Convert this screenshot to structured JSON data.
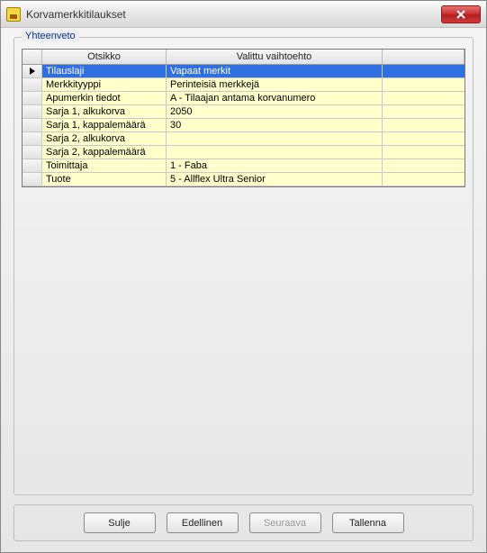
{
  "window": {
    "title": "Korvamerkkitilaukset"
  },
  "groupbox": {
    "label": "Yhteenveto"
  },
  "grid": {
    "headers": {
      "col1": "Otsikko",
      "col2": "Valittu vaihtoehto"
    },
    "rows": [
      {
        "label": "Tilauslaji",
        "value": "Vapaat merkit",
        "selected": true
      },
      {
        "label": "Merkkityyppi",
        "value": "Perinteisiä merkkejä",
        "selected": false
      },
      {
        "label": "Apumerkin tiedot",
        "value": "A - Tilaajan antama korvanumero",
        "selected": false
      },
      {
        "label": "Sarja 1, alkukorva",
        "value": "2050",
        "selected": false
      },
      {
        "label": "Sarja 1, kappalemäärä",
        "value": "30",
        "selected": false
      },
      {
        "label": "Sarja 2, alkukorva",
        "value": "",
        "selected": false
      },
      {
        "label": "Sarja 2, kappalemäärä",
        "value": "",
        "selected": false
      },
      {
        "label": "Toimittaja",
        "value": "1 - Faba",
        "selected": false
      },
      {
        "label": "Tuote",
        "value": "5 - Allflex Ultra Senior",
        "selected": false
      }
    ]
  },
  "buttons": {
    "close": "Sulje",
    "prev": "Edellinen",
    "next": "Seuraava",
    "save": "Tallenna"
  }
}
